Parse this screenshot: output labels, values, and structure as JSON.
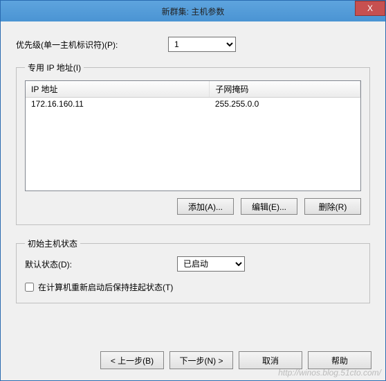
{
  "titlebar": {
    "title": "新群集: 主机参数",
    "close": "X"
  },
  "priority": {
    "label": "优先级(单一主机标识符)(P):",
    "value": "1",
    "options": [
      "1"
    ]
  },
  "ip_group": {
    "legend": "专用 IP 地址(I)",
    "columns": {
      "ip": "IP 地址",
      "mask": "子网掩码"
    },
    "rows": [
      {
        "ip": "172.16.160.11",
        "mask": "255.255.0.0"
      }
    ],
    "buttons": {
      "add": "添加(A)...",
      "edit": "编辑(E)...",
      "remove": "删除(R)"
    }
  },
  "state_group": {
    "legend": "初始主机状态",
    "default_label": "默认状态(D):",
    "default_value": "已启动",
    "options": [
      "已启动"
    ],
    "checkbox_label": "在计算机重新启动后保持挂起状态(T)",
    "checkbox_checked": false
  },
  "wizard": {
    "back": "< 上一步(B)",
    "next": "下一步(N) >",
    "cancel": "取消",
    "help": "帮助"
  },
  "watermark": "http://winos.blog.51cto.com/"
}
